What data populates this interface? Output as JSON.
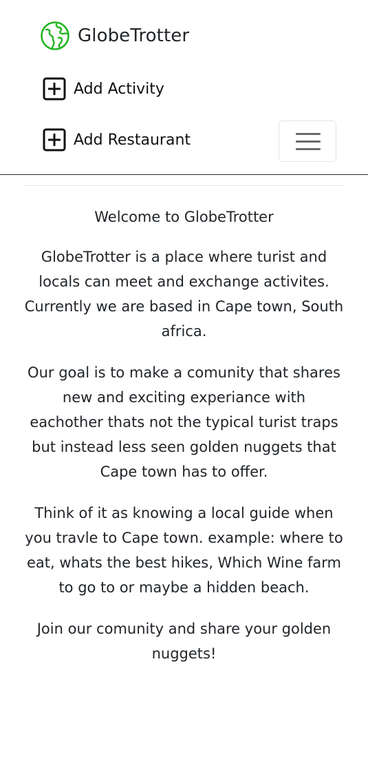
{
  "header": {
    "brand": "GlobeTrotter",
    "brand_color": "#22b522",
    "nav": [
      {
        "label": "Add Activity",
        "icon": "plus-square-icon"
      },
      {
        "label": "Add Restaurant",
        "icon": "plus-square-icon"
      }
    ],
    "toggler_icon": "hamburger-menu-icon"
  },
  "main": {
    "heading": "Welcome to GlobeTrotter",
    "paragraphs": [
      "GlobeTrotter is a place where turist and locals can meet and exchange activites. Currently we are based in Cape town, South africa.",
      "Our goal is to make a comunity that shares new and exciting experiance with eachother thats not the typical turist traps but instead less seen golden nuggets that Cape town has to offer.",
      "Think of it as knowing a local guide when you travle to Cape town. example: where to eat, whats the best hikes, Which Wine farm to go to or maybe a hidden beach.",
      "Join our comunity and share your golden nuggets!"
    ]
  }
}
